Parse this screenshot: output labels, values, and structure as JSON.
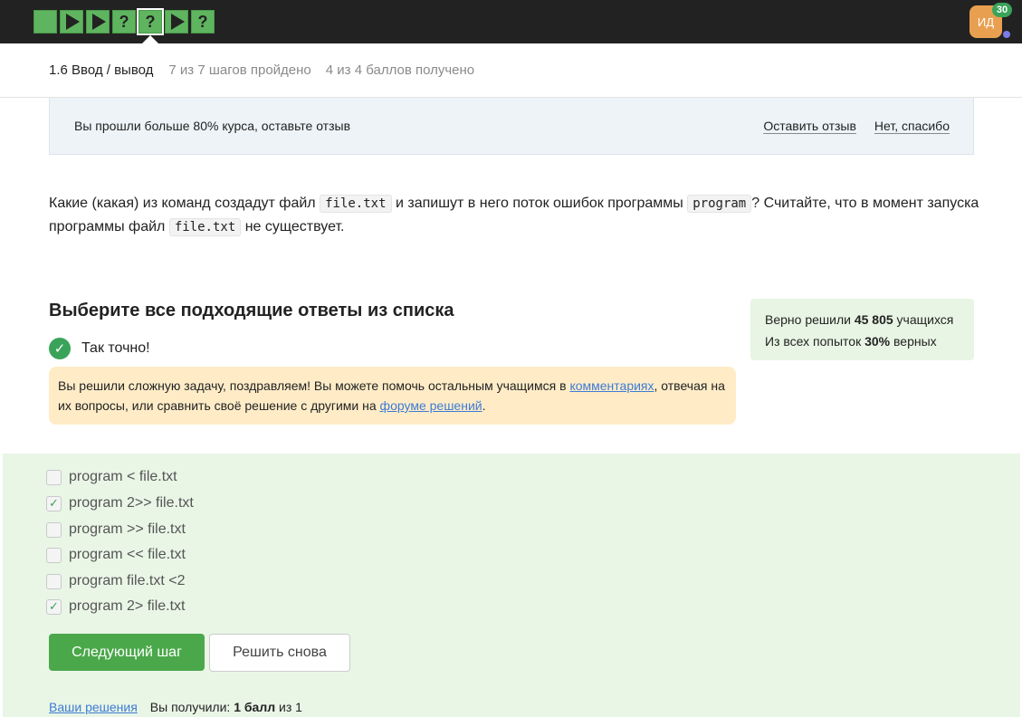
{
  "topbar": {
    "steps": [
      {
        "type": "blank",
        "name": "step-1"
      },
      {
        "type": "play",
        "name": "step-2"
      },
      {
        "type": "play",
        "name": "step-3"
      },
      {
        "type": "question",
        "name": "step-4",
        "label": "?"
      },
      {
        "type": "question",
        "name": "step-5",
        "label": "?",
        "active": true
      },
      {
        "type": "play",
        "name": "step-6"
      },
      {
        "type": "question",
        "name": "step-7",
        "label": "?"
      }
    ],
    "avatar_initials": "ИД",
    "notification_count": "30"
  },
  "lesson": {
    "title": "1.6 Ввод / вывод",
    "progress": "7 из 7 шагов пройдено",
    "score": "4 из 4 баллов  получено"
  },
  "feedback_banner": {
    "text": "Вы прошли больше 80% курса, оставьте отзыв",
    "leave_review": "Оставить отзыв",
    "no_thanks": "Нет, спасибо"
  },
  "question": {
    "part1": "Какие (какая) из команд создадут файл ",
    "code1": "file.txt",
    "part2": " и запишут в него поток ошибок программы ",
    "code2": "program",
    "part3": "? Считайте, что в момент запуска программы файл ",
    "code3": "file.txt",
    "part4": " не существует."
  },
  "answer": {
    "title": "Выберите все подходящие ответы из списка",
    "correct_text": "Так точно!",
    "hint_part1": "Вы решили сложную задачу, поздравляем! Вы можете помочь остальным учащимся в ",
    "hint_link1": "комментариях",
    "hint_part2": ", отвечая на их вопросы, или сравнить своё решение с другими на ",
    "hint_link2": "форуме решений",
    "hint_part3": "."
  },
  "stats": {
    "solved_prefix": "Верно решили ",
    "solved_count": "45 805",
    "solved_suffix": " учащихся",
    "attempts_prefix": "Из всех попыток ",
    "attempts_percent": "30%",
    "attempts_suffix": " верных"
  },
  "options": [
    {
      "label": "program < file.txt",
      "checked": false
    },
    {
      "label": "program 2>> file.txt",
      "checked": true
    },
    {
      "label": "program >> file.txt",
      "checked": false
    },
    {
      "label": "program << file.txt",
      "checked": false
    },
    {
      "label": "program file.txt <2",
      "checked": false
    },
    {
      "label": "program 2> file.txt",
      "checked": true
    }
  ],
  "buttons": {
    "next_step": "Следующий шаг",
    "retry": "Решить снова"
  },
  "footer": {
    "your_solutions": "Ваши решения",
    "received_prefix": "Вы получили: ",
    "received_points": "1 балл",
    "received_suffix": " из 1"
  },
  "colors": {
    "accent_green": "#4aa84a",
    "topbar_bg": "#222222",
    "hint_bg": "#ffecc7",
    "options_bg": "#e9f6e6",
    "link_blue": "#3d7bd4"
  }
}
